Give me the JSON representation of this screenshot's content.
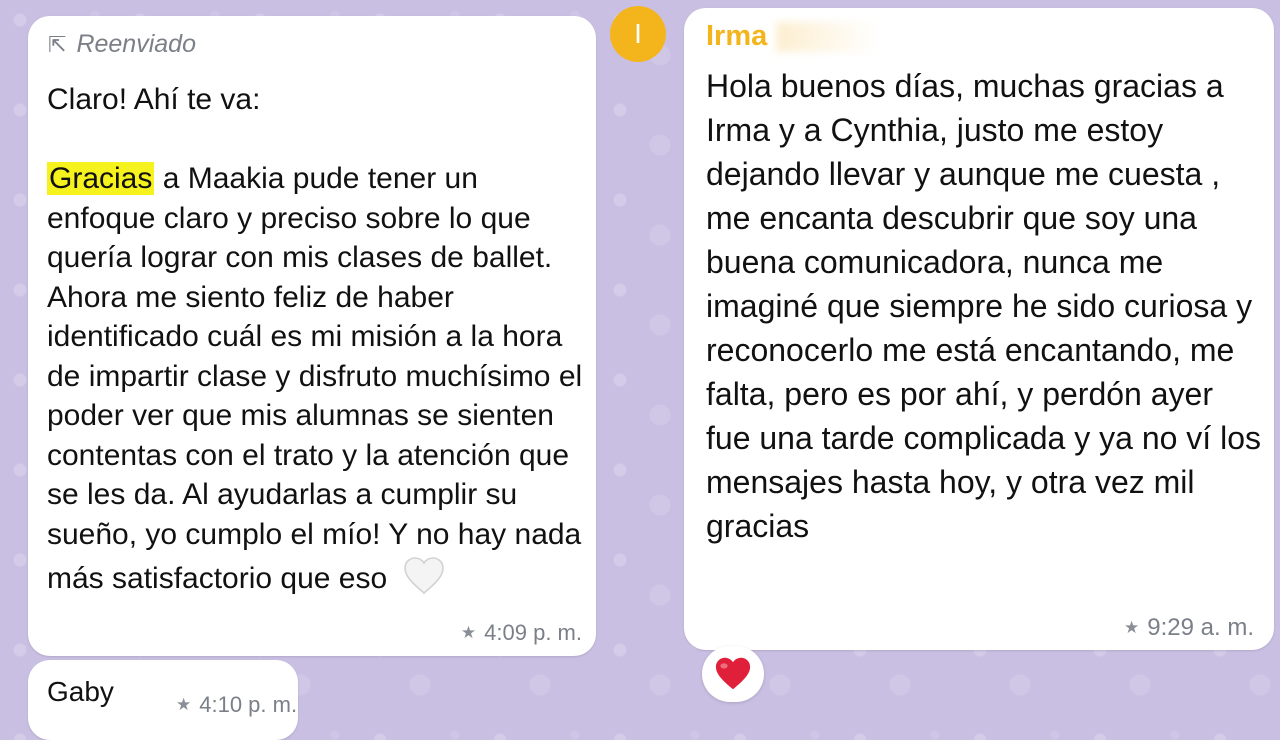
{
  "messages": {
    "forwarded": {
      "forwarded_label": "Reenviado",
      "forwarded_icon": "forward-arrow-icon",
      "intro": "Claro! Ahí te va:",
      "highlighted_word": "Gracias",
      "highlight_color": "#f5f21d",
      "body_rest": " a Maakia pude tener un enfoque claro y preciso sobre lo que quería lograr con mis clases de ballet. Ahora me siento feliz de haber identificado cuál es mi misión a la hora de impartir clase y disfruto muchísimo el poder ver que mis alumnas se sienten contentas con el trato y la atención que se les da. Al ayudarlas a cumplir su sueño, yo cumplo el mío! Y no hay nada más satisfactorio que eso",
      "emoji": "white-heart-icon",
      "starred_icon": "star-icon",
      "time": "4:09 p. m."
    },
    "gaby": {
      "text": "Gaby",
      "starred_icon": "star-icon",
      "time": "4:10 p. m."
    },
    "irma": {
      "avatar_initial": "I",
      "avatar_color": "#f4b51c",
      "sender": "Irma",
      "sender_color": "#f4b51c",
      "body": "Hola buenos días, muchas gracias a Irma y a Cynthia, justo me estoy dejando llevar y aunque me cuesta , me encanta descubrir que soy una buena comunicadora, nunca me imaginé que siempre he sido curiosa y reconocerlo me está encantando, me falta, pero es por ahí, y perdón ayer fue una tarde complicada y ya no ví los mensajes hasta hoy, y otra vez mil gracias",
      "starred_icon": "star-icon",
      "time": "9:29 a. m.",
      "reaction": "red-heart-icon"
    }
  },
  "colors": {
    "chat_background": "#c9bfe3",
    "bubble": "#ffffff",
    "meta_text": "#7b7f88"
  }
}
